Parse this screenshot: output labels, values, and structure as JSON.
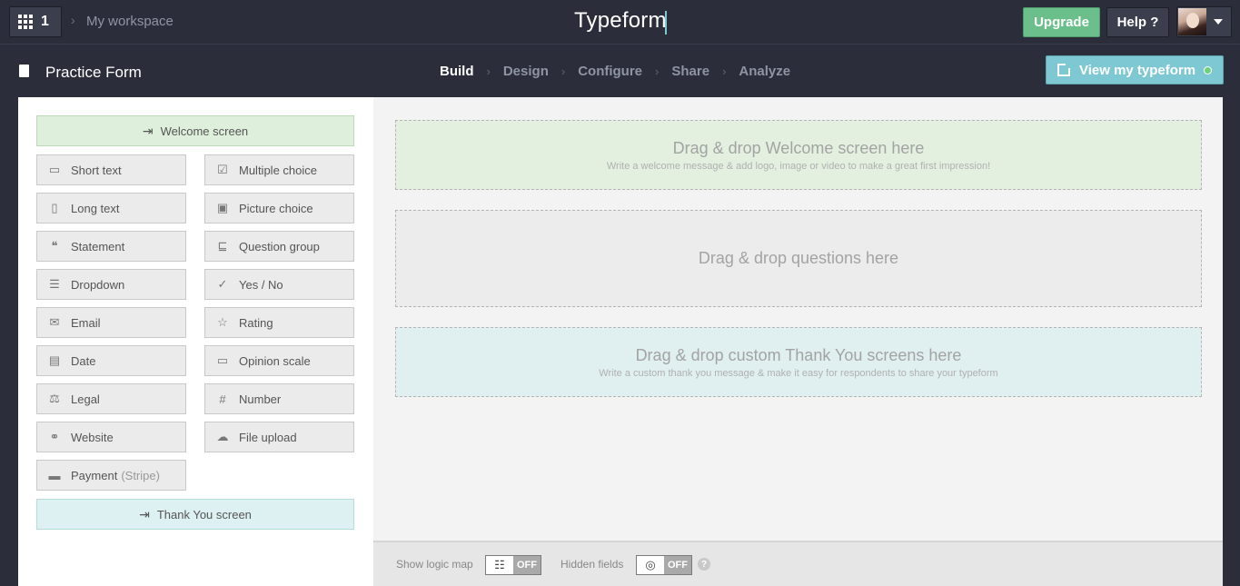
{
  "topbar": {
    "apps_count": "1",
    "workspace": "My workspace",
    "logo": "Typeform",
    "upgrade": "Upgrade",
    "help": "Help ?"
  },
  "subbar": {
    "form_title": "Practice Form",
    "steps": [
      "Build",
      "Design",
      "Configure",
      "Share",
      "Analyze"
    ],
    "active_step": "Build",
    "view_button": "View my typeform"
  },
  "question_types": {
    "welcome": {
      "label": "Welcome screen",
      "icon": "welcome-screen-icon"
    },
    "items": [
      {
        "label": "Short text",
        "icon": "short-text-icon"
      },
      {
        "label": "Multiple choice",
        "icon": "multiple-choice-icon"
      },
      {
        "label": "Long text",
        "icon": "long-text-icon"
      },
      {
        "label": "Picture choice",
        "icon": "picture-choice-icon"
      },
      {
        "label": "Statement",
        "icon": "statement-icon"
      },
      {
        "label": "Question group",
        "icon": "question-group-icon"
      },
      {
        "label": "Dropdown",
        "icon": "dropdown-icon"
      },
      {
        "label": "Yes / No",
        "icon": "yes-no-icon"
      },
      {
        "label": "Email",
        "icon": "email-icon"
      },
      {
        "label": "Rating",
        "icon": "rating-icon"
      },
      {
        "label": "Date",
        "icon": "date-icon"
      },
      {
        "label": "Opinion scale",
        "icon": "opinion-scale-icon"
      },
      {
        "label": "Legal",
        "icon": "legal-icon"
      },
      {
        "label": "Number",
        "icon": "number-icon"
      },
      {
        "label": "Website",
        "icon": "website-icon"
      },
      {
        "label": "File upload",
        "icon": "file-upload-icon"
      }
    ],
    "payment": {
      "label": "Payment",
      "sub": "(Stripe)",
      "icon": "payment-icon"
    },
    "thanks": {
      "label": "Thank You screen",
      "icon": "thank-you-screen-icon"
    }
  },
  "canvas": {
    "welcome_title": "Drag & drop Welcome screen here",
    "welcome_sub": "Write a welcome message & add logo, image or video to make a great first impression!",
    "questions_title": "Drag & drop questions here",
    "thanks_title": "Drag & drop custom Thank You screens here",
    "thanks_sub": "Write a custom thank you message & make it easy for respondents to share your typeform"
  },
  "footer": {
    "logic_map_label": "Show logic map",
    "logic_map_state": "OFF",
    "hidden_fields_label": "Hidden fields",
    "hidden_fields_state": "OFF",
    "help_mark": "?"
  }
}
